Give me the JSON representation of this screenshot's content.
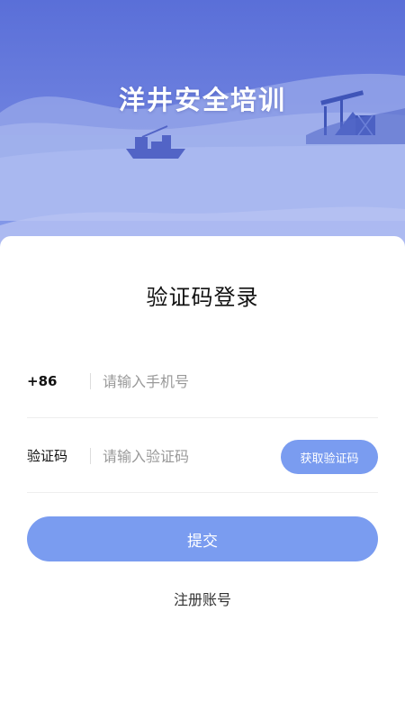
{
  "header": {
    "app_title": "洋井安全培训"
  },
  "login": {
    "title": "验证码登录",
    "phone": {
      "prefix": "+86",
      "placeholder": "请输入手机号",
      "value": ""
    },
    "code": {
      "label": "验证码",
      "placeholder": "请输入验证码",
      "value": "",
      "button_label": "获取验证码"
    },
    "submit_label": "提交",
    "register_label": "注册账号"
  },
  "colors": {
    "hero_top": "#5f74dc",
    "hero_bottom": "#7f96e8",
    "button": "#7a9cf0"
  }
}
